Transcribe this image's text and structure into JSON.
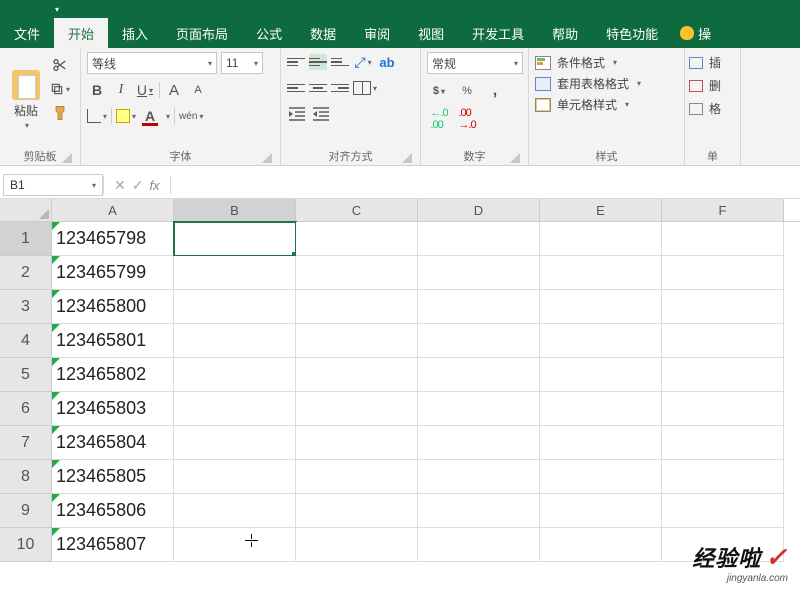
{
  "tabs": {
    "file": "文件",
    "home": "开始",
    "insert": "插入",
    "pageLayout": "页面布局",
    "formulas": "公式",
    "data": "数据",
    "review": "审阅",
    "view": "视图",
    "developer": "开发工具",
    "help": "帮助",
    "special": "特色功能",
    "tellMe": "操"
  },
  "clipboard": {
    "paste": "粘贴",
    "label": "剪贴板"
  },
  "font": {
    "name": "等线",
    "size": "11",
    "bold": "B",
    "italic": "I",
    "underline": "U",
    "label": "字体",
    "A": "A",
    "wen": "wén"
  },
  "align": {
    "label": "对齐方式",
    "ab": "ab"
  },
  "number": {
    "format": "常规",
    "label": "数字",
    "percent": "%",
    "comma": ",",
    "inc": ".0",
    "inc2": ".00",
    "dec": ".00",
    "dec2": ".0",
    "currency": "$"
  },
  "styles": {
    "conditional": "条件格式",
    "tableFormat": "套用表格格式",
    "cellStyles": "单元格样式",
    "label": "样式"
  },
  "cells": {
    "insert": "插",
    "delete": "删",
    "format": "格",
    "label": "单"
  },
  "nameBox": "B1",
  "fx": "fx",
  "formulaValue": "",
  "columns": [
    "A",
    "B",
    "C",
    "D",
    "E",
    "F"
  ],
  "rows": [
    {
      "n": "1",
      "A": "123465798"
    },
    {
      "n": "2",
      "A": "123465799"
    },
    {
      "n": "3",
      "A": "123465800"
    },
    {
      "n": "4",
      "A": "123465801"
    },
    {
      "n": "5",
      "A": "123465802"
    },
    {
      "n": "6",
      "A": "123465803"
    },
    {
      "n": "7",
      "A": "123465804"
    },
    {
      "n": "8",
      "A": "123465805"
    },
    {
      "n": "9",
      "A": "123465806"
    },
    {
      "n": "10",
      "A": "123465807"
    }
  ],
  "selected": {
    "row": 0,
    "col": "B"
  },
  "watermark": {
    "main": "经验啦",
    "check": "✓",
    "sub": "jingyanla.com"
  }
}
